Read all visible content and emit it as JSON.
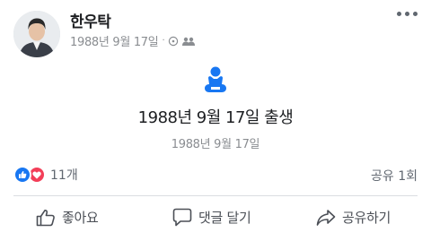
{
  "post": {
    "author": "한우탁",
    "date": "1988년 9월 17일",
    "privacy_icon": "globe-icon",
    "audience_icon": "friends-icon"
  },
  "event": {
    "icon": "baby-icon",
    "title": "1988년 9월 17일 출생",
    "date": "1988년 9월 17일"
  },
  "reactions": {
    "types": [
      "like",
      "love"
    ],
    "count": "11개",
    "shares": "공유 1회"
  },
  "actions": {
    "like": "좋아요",
    "comment": "댓글 달기",
    "share": "공유하기"
  },
  "colors": {
    "accent_blue": "#1877f2",
    "love_red": "#f33e58",
    "text_secondary": "#8a8d91"
  }
}
